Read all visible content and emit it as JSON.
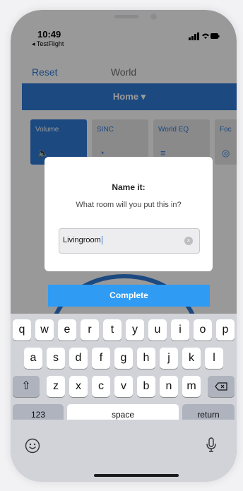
{
  "status": {
    "time": "10:49",
    "back_app": "◂ TestFlight",
    "icons": "∙∙∙ ≈ ▭"
  },
  "nav": {
    "reset": "Reset",
    "title": "World"
  },
  "home": {
    "label": "Home ▾"
  },
  "tiles": [
    {
      "label": "Volume",
      "icon": "🔈",
      "active": true
    },
    {
      "label": "SINC",
      "icon": "◔",
      "active": false
    },
    {
      "label": "World EQ",
      "icon": "≡",
      "active": false
    },
    {
      "label": "Foc",
      "icon": "◎",
      "active": false
    }
  ],
  "dialog": {
    "title": "Name it:",
    "message": "What room will you put this in?",
    "input_value": "Livingroom"
  },
  "complete_label": "Complete",
  "keyboard": {
    "row1": [
      "q",
      "w",
      "e",
      "r",
      "t",
      "y",
      "u",
      "i",
      "o",
      "p"
    ],
    "row2": [
      "a",
      "s",
      "d",
      "f",
      "g",
      "h",
      "j",
      "k",
      "l"
    ],
    "row3": [
      "z",
      "x",
      "c",
      "v",
      "b",
      "n",
      "m"
    ],
    "numbers_label": "123",
    "space_label": "space",
    "return_label": "return"
  },
  "colors": {
    "accent": "#2f7bd6",
    "complete": "#2f9bf2"
  }
}
